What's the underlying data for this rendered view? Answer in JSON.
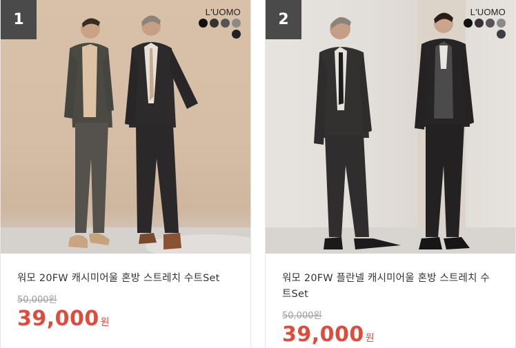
{
  "products": [
    {
      "rank": "1",
      "brand": "L'UOMO",
      "swatch_colors": [
        "#111111",
        "#333333",
        "#555555",
        "#8a8a8a",
        "#222222"
      ],
      "title": "워모 20FW 캐시미어울 혼방 스트레치 수트Set",
      "original_price": "50,000원",
      "price": "39,000",
      "currency": "원"
    },
    {
      "rank": "2",
      "brand": "L'UOMO",
      "swatch_colors": [
        "#111111",
        "#333333",
        "#555555",
        "#8a8a8a",
        "#3b3f44"
      ],
      "title": "워모 20FW 플란넬 캐시미어울 혼방 스트레치 수트Set",
      "original_price": "50,000원",
      "price": "39,000",
      "currency": "원"
    }
  ]
}
